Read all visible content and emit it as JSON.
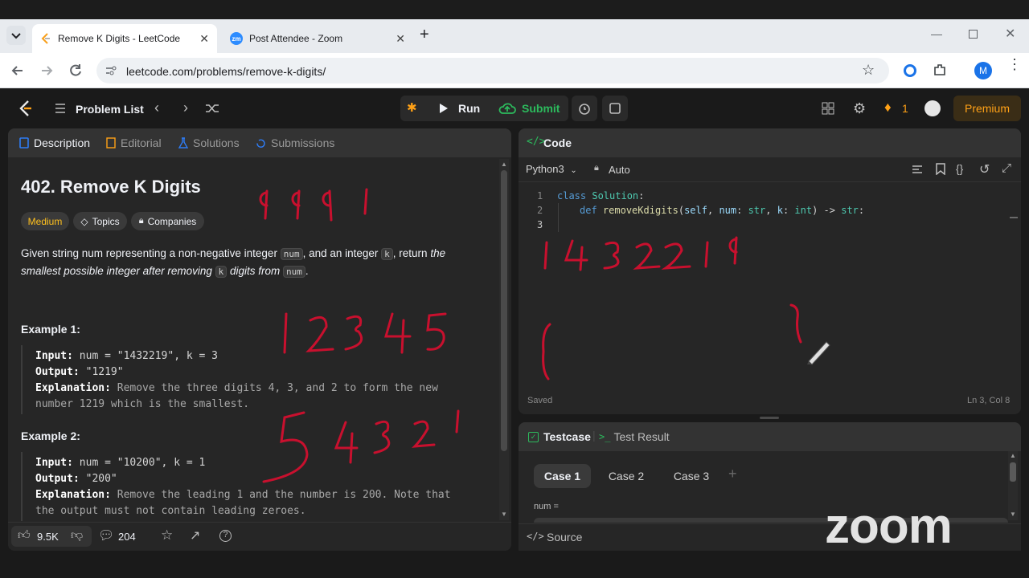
{
  "browser": {
    "tabs": [
      {
        "title": "Remove K Digits - LeetCode",
        "favicon": "leetcode-icon"
      },
      {
        "title": "Post Attendee - Zoom",
        "favicon": "zoom-icon",
        "favicon_text": "zm"
      }
    ],
    "new_tab_symbol": "+",
    "url": "leetcode.com/problems/remove-k-digits/",
    "profile_initial": "M"
  },
  "nav": {
    "problem_list": "Problem List",
    "run": "Run",
    "submit": "Submit",
    "streak": "1",
    "premium": "Premium"
  },
  "description_panel": {
    "tabs": [
      "Description",
      "Editorial",
      "Solutions",
      "Submissions"
    ],
    "title": "402. Remove K Digits",
    "difficulty": "Medium",
    "topics": "Topics",
    "companies": "Companies",
    "statement_parts": [
      "Given string num representing a non-negative integer ",
      "num",
      ", and an integer ",
      "k",
      ", return ",
      "the smallest possible integer after removing ",
      "k",
      " digits from ",
      "num",
      "."
    ],
    "examples": [
      {
        "label": "Example 1:",
        "input_key": "Input:",
        "input": " num = \"1432219\", k = 3",
        "output_key": "Output:",
        "output": " \"1219\"",
        "explanation_key": "Explanation:",
        "explanation_1": " Remove the three digits 4, 3, and 2 to form the new",
        "explanation_2": "number 1219 which is the smallest."
      },
      {
        "label": "Example 2:",
        "input_key": "Input:",
        "input": " num = \"10200\", k = 1",
        "output_key": "Output:",
        "output": " \"200\"",
        "explanation_key": "Explanation:",
        "explanation_1": " Remove the leading 1 and the number is 200. Note that",
        "explanation_2": "the output must not contain leading zeroes."
      }
    ],
    "footer": {
      "likes": "9.5K",
      "comments": "204"
    }
  },
  "code_panel": {
    "title": "Code",
    "language": "Python3",
    "mode": "Auto",
    "line_numbers": [
      "1",
      "2",
      "3"
    ],
    "code_line1": {
      "kw": "class",
      "name": "Solution",
      "colon": ":"
    },
    "code_line2": {
      "kw": "def",
      "fn": "removeKdigits",
      "p1": "self",
      "p2": "num",
      "t2": "str",
      "p3": "k",
      "t3": "int",
      "ret": "str"
    },
    "status": "Saved",
    "cursor": "Ln 3, Col 8"
  },
  "testcase_panel": {
    "tabs": [
      "Testcase",
      "Test Result"
    ],
    "cases": [
      "Case 1",
      "Case 2",
      "Case 3"
    ],
    "add": "+",
    "param_label": "num =",
    "source": "Source"
  },
  "annotations": {
    "drawing_1": "9991",
    "drawing_2": "1432219",
    "drawing_3": "12345",
    "drawing_4": "54321"
  },
  "zoom_watermark": "zoom",
  "colors": {
    "accent_blue": "#2e7cf6",
    "medium_yellow": "#ffc01e",
    "submit_green": "#2cbb5d",
    "ink_red": "#c8102e",
    "streak_orange": "#ffa116"
  }
}
